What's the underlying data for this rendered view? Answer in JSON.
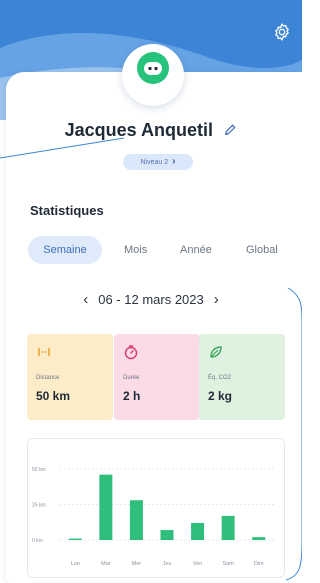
{
  "profile": {
    "name": "Jacques Anquetil",
    "level_label": "Niveau 2",
    "level_chevron": "›"
  },
  "stats_section": {
    "title": "Statistiques",
    "tabs": [
      {
        "label": "Semaine",
        "active": true
      },
      {
        "label": "Mois",
        "active": false
      },
      {
        "label": "Année",
        "active": false
      },
      {
        "label": "Global",
        "active": false
      }
    ],
    "period": {
      "prev": "‹",
      "label": "06 - 12 mars 2023",
      "next": "›"
    },
    "cards": [
      {
        "icon": "distance-icon",
        "label": "Distance",
        "value": "50 km",
        "color": "#fdecc8"
      },
      {
        "icon": "stopwatch-icon",
        "label": "Durée",
        "value": "2 h",
        "color": "#fbdbe6"
      },
      {
        "icon": "leaf-icon",
        "label": "Éq. CO2",
        "value": "2 kg",
        "color": "#dff1df"
      }
    ]
  },
  "colors": {
    "accent": "#3f6fbd",
    "header_blue": "#3c84d6",
    "avatar_green": "#27c27c",
    "bar_green": "#2fbe7c"
  },
  "chart_data": {
    "type": "bar",
    "categories": [
      "Lun",
      "Mar",
      "Mer",
      "Jeu",
      "Ven",
      "Sam",
      "Dim"
    ],
    "values": [
      1,
      46,
      28,
      7,
      12,
      17,
      2
    ],
    "ytick_labels": [
      "50 km",
      "25 km",
      "0 km"
    ],
    "yticks": [
      50,
      25,
      0
    ],
    "ylim": [
      0,
      50
    ],
    "grid": true,
    "title": "",
    "xlabel": "",
    "ylabel": ""
  }
}
